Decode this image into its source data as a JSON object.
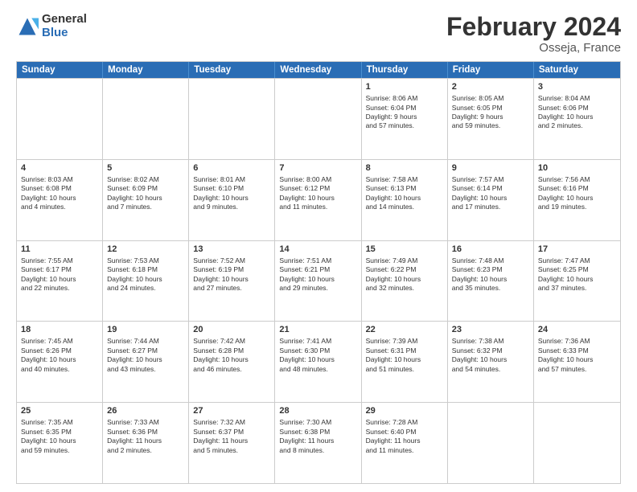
{
  "header": {
    "logo": {
      "general": "General",
      "blue": "Blue"
    },
    "title": "February 2024",
    "subtitle": "Osseja, France"
  },
  "days_of_week": [
    "Sunday",
    "Monday",
    "Tuesday",
    "Wednesday",
    "Thursday",
    "Friday",
    "Saturday"
  ],
  "weeks": [
    [
      {
        "day": "",
        "info": ""
      },
      {
        "day": "",
        "info": ""
      },
      {
        "day": "",
        "info": ""
      },
      {
        "day": "",
        "info": ""
      },
      {
        "day": "1",
        "info": "Sunrise: 8:06 AM\nSunset: 6:04 PM\nDaylight: 9 hours\nand 57 minutes."
      },
      {
        "day": "2",
        "info": "Sunrise: 8:05 AM\nSunset: 6:05 PM\nDaylight: 9 hours\nand 59 minutes."
      },
      {
        "day": "3",
        "info": "Sunrise: 8:04 AM\nSunset: 6:06 PM\nDaylight: 10 hours\nand 2 minutes."
      }
    ],
    [
      {
        "day": "4",
        "info": "Sunrise: 8:03 AM\nSunset: 6:08 PM\nDaylight: 10 hours\nand 4 minutes."
      },
      {
        "day": "5",
        "info": "Sunrise: 8:02 AM\nSunset: 6:09 PM\nDaylight: 10 hours\nand 7 minutes."
      },
      {
        "day": "6",
        "info": "Sunrise: 8:01 AM\nSunset: 6:10 PM\nDaylight: 10 hours\nand 9 minutes."
      },
      {
        "day": "7",
        "info": "Sunrise: 8:00 AM\nSunset: 6:12 PM\nDaylight: 10 hours\nand 11 minutes."
      },
      {
        "day": "8",
        "info": "Sunrise: 7:58 AM\nSunset: 6:13 PM\nDaylight: 10 hours\nand 14 minutes."
      },
      {
        "day": "9",
        "info": "Sunrise: 7:57 AM\nSunset: 6:14 PM\nDaylight: 10 hours\nand 17 minutes."
      },
      {
        "day": "10",
        "info": "Sunrise: 7:56 AM\nSunset: 6:16 PM\nDaylight: 10 hours\nand 19 minutes."
      }
    ],
    [
      {
        "day": "11",
        "info": "Sunrise: 7:55 AM\nSunset: 6:17 PM\nDaylight: 10 hours\nand 22 minutes."
      },
      {
        "day": "12",
        "info": "Sunrise: 7:53 AM\nSunset: 6:18 PM\nDaylight: 10 hours\nand 24 minutes."
      },
      {
        "day": "13",
        "info": "Sunrise: 7:52 AM\nSunset: 6:19 PM\nDaylight: 10 hours\nand 27 minutes."
      },
      {
        "day": "14",
        "info": "Sunrise: 7:51 AM\nSunset: 6:21 PM\nDaylight: 10 hours\nand 29 minutes."
      },
      {
        "day": "15",
        "info": "Sunrise: 7:49 AM\nSunset: 6:22 PM\nDaylight: 10 hours\nand 32 minutes."
      },
      {
        "day": "16",
        "info": "Sunrise: 7:48 AM\nSunset: 6:23 PM\nDaylight: 10 hours\nand 35 minutes."
      },
      {
        "day": "17",
        "info": "Sunrise: 7:47 AM\nSunset: 6:25 PM\nDaylight: 10 hours\nand 37 minutes."
      }
    ],
    [
      {
        "day": "18",
        "info": "Sunrise: 7:45 AM\nSunset: 6:26 PM\nDaylight: 10 hours\nand 40 minutes."
      },
      {
        "day": "19",
        "info": "Sunrise: 7:44 AM\nSunset: 6:27 PM\nDaylight: 10 hours\nand 43 minutes."
      },
      {
        "day": "20",
        "info": "Sunrise: 7:42 AM\nSunset: 6:28 PM\nDaylight: 10 hours\nand 46 minutes."
      },
      {
        "day": "21",
        "info": "Sunrise: 7:41 AM\nSunset: 6:30 PM\nDaylight: 10 hours\nand 48 minutes."
      },
      {
        "day": "22",
        "info": "Sunrise: 7:39 AM\nSunset: 6:31 PM\nDaylight: 10 hours\nand 51 minutes."
      },
      {
        "day": "23",
        "info": "Sunrise: 7:38 AM\nSunset: 6:32 PM\nDaylight: 10 hours\nand 54 minutes."
      },
      {
        "day": "24",
        "info": "Sunrise: 7:36 AM\nSunset: 6:33 PM\nDaylight: 10 hours\nand 57 minutes."
      }
    ],
    [
      {
        "day": "25",
        "info": "Sunrise: 7:35 AM\nSunset: 6:35 PM\nDaylight: 10 hours\nand 59 minutes."
      },
      {
        "day": "26",
        "info": "Sunrise: 7:33 AM\nSunset: 6:36 PM\nDaylight: 11 hours\nand 2 minutes."
      },
      {
        "day": "27",
        "info": "Sunrise: 7:32 AM\nSunset: 6:37 PM\nDaylight: 11 hours\nand 5 minutes."
      },
      {
        "day": "28",
        "info": "Sunrise: 7:30 AM\nSunset: 6:38 PM\nDaylight: 11 hours\nand 8 minutes."
      },
      {
        "day": "29",
        "info": "Sunrise: 7:28 AM\nSunset: 6:40 PM\nDaylight: 11 hours\nand 11 minutes."
      },
      {
        "day": "",
        "info": ""
      },
      {
        "day": "",
        "info": ""
      }
    ]
  ]
}
